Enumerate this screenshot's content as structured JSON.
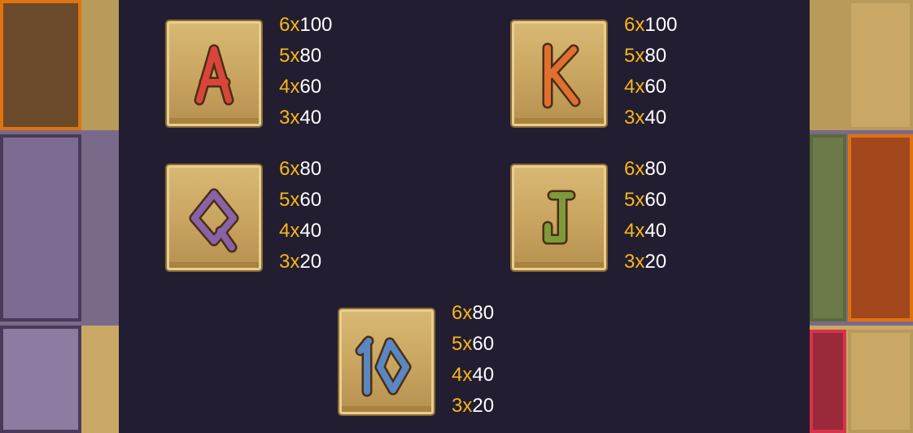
{
  "paytable": [
    {
      "symbol": "A",
      "color": "#d9453a",
      "pays": [
        {
          "count": "6x",
          "value": "100"
        },
        {
          "count": "5x",
          "value": "80"
        },
        {
          "count": "4x",
          "value": "60"
        },
        {
          "count": "3x",
          "value": "40"
        }
      ]
    },
    {
      "symbol": "K",
      "color": "#e07030",
      "pays": [
        {
          "count": "6x",
          "value": "100"
        },
        {
          "count": "5x",
          "value": "80"
        },
        {
          "count": "4x",
          "value": "60"
        },
        {
          "count": "3x",
          "value": "40"
        }
      ]
    },
    {
      "symbol": "Q",
      "color": "#8a62a8",
      "pays": [
        {
          "count": "6x",
          "value": "80"
        },
        {
          "count": "5x",
          "value": "60"
        },
        {
          "count": "4x",
          "value": "40"
        },
        {
          "count": "3x",
          "value": "20"
        }
      ]
    },
    {
      "symbol": "J",
      "color": "#7d9a3c",
      "pays": [
        {
          "count": "6x",
          "value": "80"
        },
        {
          "count": "5x",
          "value": "60"
        },
        {
          "count": "4x",
          "value": "40"
        },
        {
          "count": "3x",
          "value": "20"
        }
      ]
    },
    {
      "symbol": "10",
      "color": "#5a86c4",
      "pays": [
        {
          "count": "6x",
          "value": "80"
        },
        {
          "count": "5x",
          "value": "60"
        },
        {
          "count": "4x",
          "value": "40"
        },
        {
          "count": "3x",
          "value": "20"
        }
      ]
    }
  ],
  "colors": {
    "count_accent": "#f7b718",
    "value_text": "#ffffff",
    "panel_bg": "#221d31"
  }
}
